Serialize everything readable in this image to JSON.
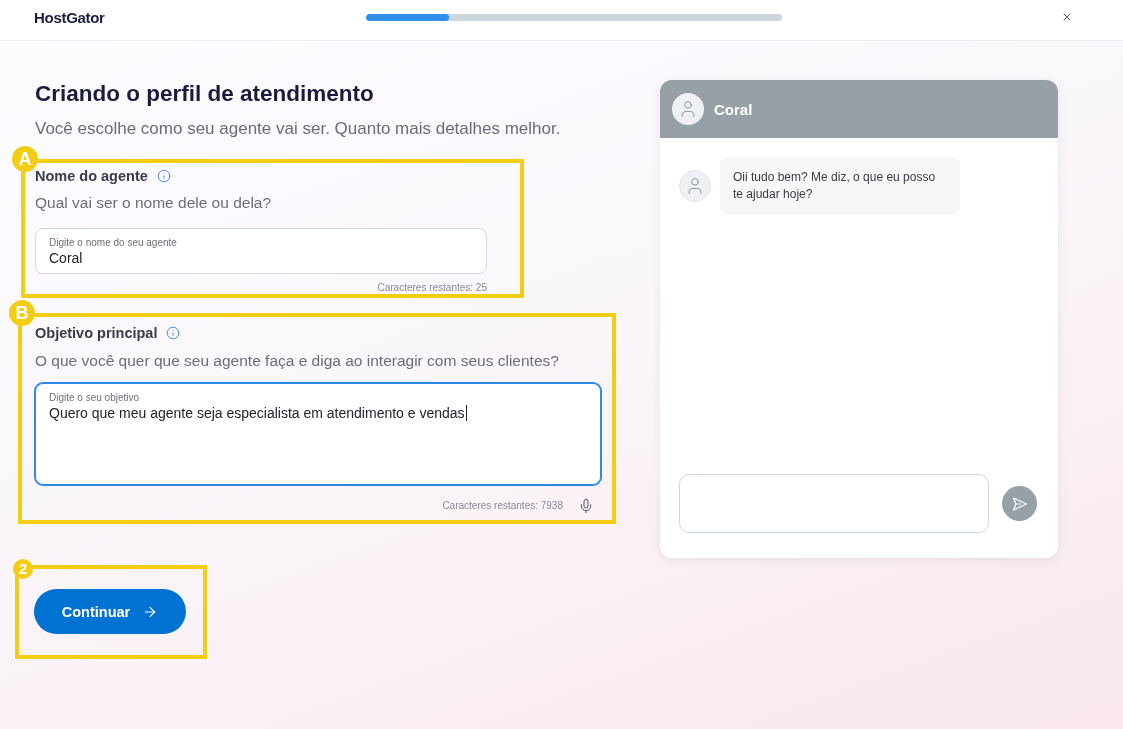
{
  "header": {
    "logo": "HostGator",
    "progress": {
      "level": 0.2
    }
  },
  "title": "Criando o perfil de atendimento",
  "subtitle": "Você escolhe como seu agente vai ser. Quanto mais detalhes melhor.",
  "sections": [
    {
      "badge": "A",
      "label": "Nome do agente",
      "question": "Qual vai ser o nome dele ou dela?",
      "field": {
        "kind": "input",
        "label": "Digite o nome do seu agente",
        "value": "Coral",
        "focused": false
      },
      "counter": "Caracteres restantes: 25",
      "voice_input": false
    },
    {
      "badge": "B",
      "label": "Objetivo principal",
      "question": "O que você quer que seu agente faça e diga ao interagir com seus clientes?",
      "field": {
        "kind": "textarea",
        "label": "Digite o seu objetivo",
        "value": "Quero que meu agente seja especialista em atendimento e vendas",
        "focused": true
      },
      "counter": "Caracteres restantes: 7938",
      "voice_input": true
    }
  ],
  "continue_button": {
    "badge": "2",
    "label": "Continuar"
  },
  "chat": {
    "title": "Coral",
    "messages": [
      {
        "text": "Oii tudo bem? Me diz, o que eu posso te ajudar hoje?"
      }
    ]
  }
}
